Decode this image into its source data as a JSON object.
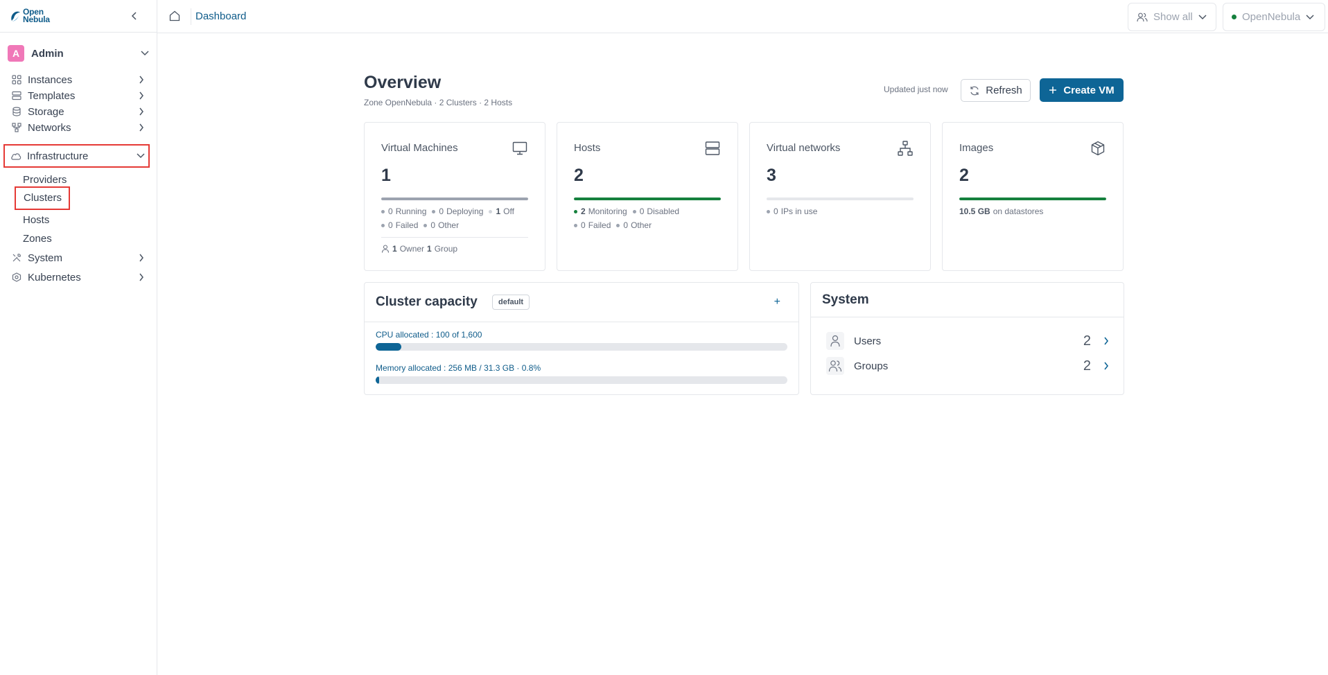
{
  "app": {
    "logo_line1": "Open",
    "logo_line2": "Nebula"
  },
  "sidebar": {
    "user": {
      "initial": "A",
      "name": "Admin"
    },
    "items": [
      {
        "label": "Instances",
        "icon": "grid-icon"
      },
      {
        "label": "Templates",
        "icon": "templates-icon"
      },
      {
        "label": "Storage",
        "icon": "database-icon"
      },
      {
        "label": "Networks",
        "icon": "network-icon"
      },
      {
        "label": "Infrastructure",
        "icon": "cloud-icon",
        "expanded": true,
        "children": [
          "Providers",
          "Clusters",
          "Hosts",
          "Zones"
        ]
      },
      {
        "label": "System",
        "icon": "tools-icon"
      },
      {
        "label": "Kubernetes",
        "icon": "kubernetes-icon"
      }
    ]
  },
  "topbar": {
    "breadcrumb": "Dashboard",
    "group_filter": "Show all",
    "zone": "OpenNebula",
    "zone_status_color": "#15803d"
  },
  "overview": {
    "title": "Overview",
    "subtitle": "Zone OpenNebula · 2 Clusters · 2 Hosts",
    "updated": "Updated just now",
    "refresh_label": "Refresh",
    "create_label": "Create VM"
  },
  "cards": {
    "vms": {
      "title": "Virtual Machines",
      "value": "1",
      "bar_fill": 1.0,
      "bar_color": "#9ca3af",
      "running_n": "0",
      "running": "Running",
      "deploying_n": "0",
      "deploying": "Deploying",
      "off_n": "1",
      "off": "Off",
      "failed_n": "0",
      "failed": "Failed",
      "other_n": "0",
      "other": "Other",
      "owner_n": "1",
      "owner": "Owner",
      "group_n": "1",
      "group": "Group"
    },
    "hosts": {
      "title": "Hosts",
      "value": "2",
      "bar_fill": 1.0,
      "bar_color": "#15803d",
      "monitoring_n": "2",
      "monitoring": "Monitoring",
      "disabled_n": "0",
      "disabled": "Disabled",
      "failed_n": "0",
      "failed": "Failed",
      "other_n": "0",
      "other": "Other"
    },
    "vnets": {
      "title": "Virtual networks",
      "value": "3",
      "bar_fill": 0.0,
      "ips_n": "0",
      "ips": "IPs in use"
    },
    "images": {
      "title": "Images",
      "value": "2",
      "bar_fill": 1.0,
      "bar_color": "#15803d",
      "size": "10.5 GB",
      "size_suffix": "on datastores"
    }
  },
  "capacity": {
    "title": "Cluster capacity",
    "badge": "default",
    "add": "+",
    "cpu_label": "CPU allocated : 100 of 1,600",
    "cpu_fraction": 0.0625,
    "mem_label": "Memory allocated : 256 MB / 31.3 GB · 0.8%",
    "mem_fraction": 0.008
  },
  "system": {
    "title": "System",
    "rows": [
      {
        "label": "Users",
        "count": "2",
        "icon": "user-icon"
      },
      {
        "label": "Groups",
        "count": "2",
        "icon": "users-icon"
      }
    ]
  },
  "colors": {
    "accent": "#0e6596",
    "success": "#15803d",
    "highlight": "#e53935"
  }
}
